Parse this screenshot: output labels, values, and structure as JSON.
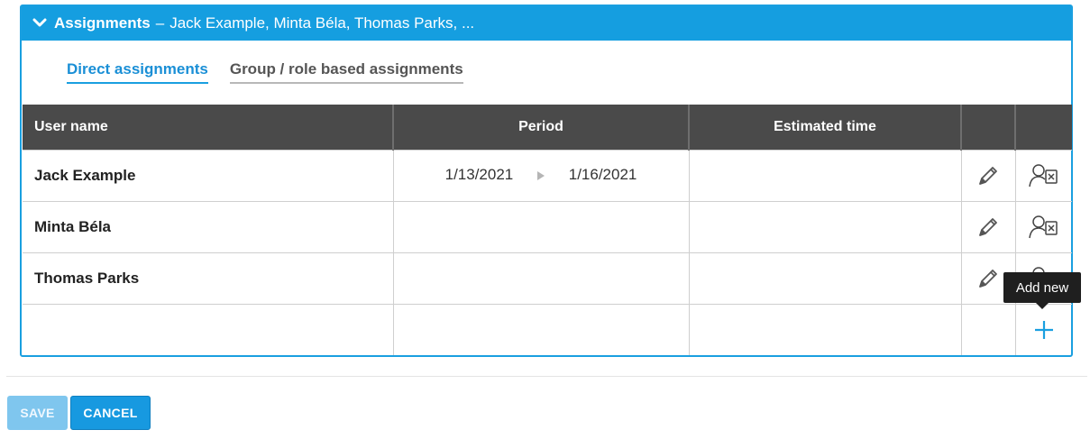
{
  "panel": {
    "title": "Assignments",
    "separator": "–",
    "subtitle": "Jack Example, Minta Béla, Thomas Parks, ..."
  },
  "tabs": [
    {
      "label": "Direct assignments",
      "active": true
    },
    {
      "label": "Group / role based assignments",
      "active": false
    }
  ],
  "table": {
    "headers": [
      "User name",
      "Period",
      "Estimated time",
      "",
      ""
    ],
    "rows": [
      {
        "user": "Jack Example",
        "period_start": "1/13/2021",
        "period_end": "1/16/2021",
        "estimated": ""
      },
      {
        "user": "Minta Béla",
        "period_start": "",
        "period_end": "",
        "estimated": ""
      },
      {
        "user": "Thomas Parks",
        "period_start": "",
        "period_end": "",
        "estimated": ""
      }
    ]
  },
  "tooltip": {
    "text": "Add new"
  },
  "buttons": {
    "save": "SAVE",
    "cancel": "CANCEL"
  },
  "icons": {
    "collapse": "chevron-down-icon",
    "period_arrow": "triangle-right-icon",
    "edit": "pencil-icon",
    "remove": "remove-user-icon",
    "add": "plus-icon"
  },
  "colors": {
    "accent": "#159ee0",
    "header_bg": "#4a4a4a",
    "save_disabled": "#7fc6ee"
  }
}
